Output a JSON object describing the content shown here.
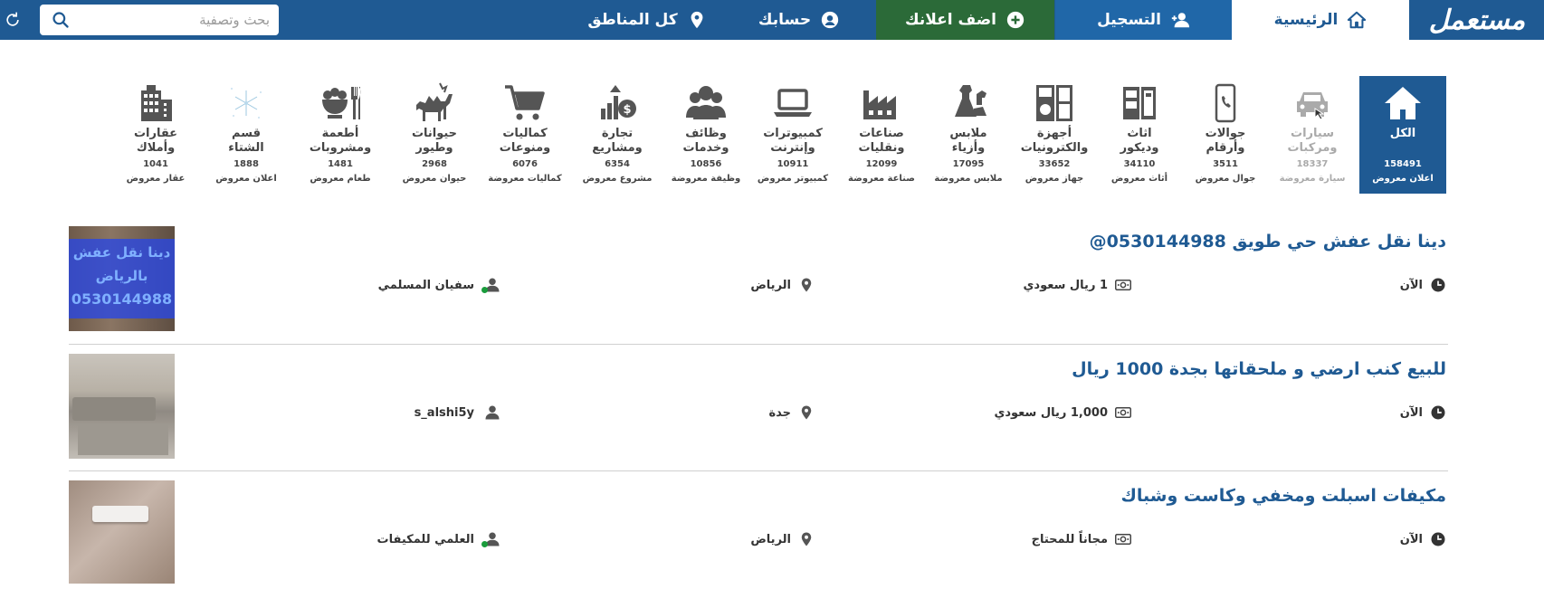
{
  "nav": {
    "logo": "مستعمل",
    "home": "الرئيسية",
    "register": "التسجيل",
    "add_ad": "اضف اعلانك",
    "account": "حسابك",
    "regions": "كل المناطق",
    "search_placeholder": "بحث وتصفية",
    "colors": {
      "bar": "#1f5a93",
      "add_button": "#2b6a38",
      "register_button": "#2067a8"
    }
  },
  "categories": [
    {
      "label1": "الكل",
      "label2": "",
      "count": "158491",
      "unit": "اعلان معروض",
      "icon": "home-icon",
      "active": true
    },
    {
      "label1": "سيارات",
      "label2": "ومركبات",
      "count": "18337",
      "unit": "سيارة معروضة",
      "icon": "car-icon",
      "hovered": true
    },
    {
      "label1": "جوالات",
      "label2": "وأرقام",
      "count": "3511",
      "unit": "جوال معروض",
      "icon": "phone-icon"
    },
    {
      "label1": "اثاث",
      "label2": "وديكور",
      "count": "34110",
      "unit": "أثاث معروض",
      "icon": "furniture-icon"
    },
    {
      "label1": "أجهزة",
      "label2": "والكترونيات",
      "count": "33652",
      "unit": "جهاز معروض",
      "icon": "appliances-icon"
    },
    {
      "label1": "ملابس",
      "label2": "وأزياء",
      "count": "17095",
      "unit": "ملابس معروضة",
      "icon": "clothes-icon"
    },
    {
      "label1": "صناعات",
      "label2": "ونقليات",
      "count": "12099",
      "unit": "صناعة معروضة",
      "icon": "factory-icon"
    },
    {
      "label1": "كمبيوترات",
      "label2": "وإنترنت",
      "count": "10911",
      "unit": "كمبيوتر معروض",
      "icon": "laptop-icon"
    },
    {
      "label1": "وظائف",
      "label2": "وخدمات",
      "count": "10856",
      "unit": "وظيفة معروضة",
      "icon": "people-icon"
    },
    {
      "label1": "تجارة",
      "label2": "ومشاريع",
      "count": "6354",
      "unit": "مشروع معروض",
      "icon": "business-growth-icon"
    },
    {
      "label1": "كماليات",
      "label2": "ومنوعات",
      "count": "6076",
      "unit": "كماليات معروضة",
      "icon": "cart-icon"
    },
    {
      "label1": "حيوانات",
      "label2": "وطيور",
      "count": "2968",
      "unit": "حيوان معروض",
      "icon": "camel-icon"
    },
    {
      "label1": "أطعمة",
      "label2": "ومشروبات",
      "count": "1481",
      "unit": "طعام معروض",
      "icon": "food-icon"
    },
    {
      "label1": "قسم",
      "label2": "الشتاء",
      "count": "1888",
      "unit": "اعلان معروض",
      "icon": "snowflake-icon"
    },
    {
      "label1": "عقارات",
      "label2": "وأملاك",
      "count": "1041",
      "unit": "عقار معروض",
      "icon": "building-icon"
    }
  ],
  "listings": [
    {
      "title": "دينا نقل عفش حي طويق 0530144988@",
      "time": "الآن",
      "price": "1 ريال سعودي",
      "city": "الرياض",
      "user": "سفيان المسلمي",
      "online": true,
      "thumb_text": [
        "دينا نقل عفش",
        "بالرياض",
        "0530144988"
      ]
    },
    {
      "title": "للبيع كنب ارضي و ملحقاتها بجدة 1000 ريال",
      "time": "الآن",
      "price": "1,000 ريال سعودي",
      "city": "جدة",
      "user": "s_alshi5y",
      "online": false
    },
    {
      "title": "مكيفات اسبلت ومخفي وكاست وشباك",
      "time": "الآن",
      "price": "مجاناً للمحتاج",
      "city": "الرياض",
      "user": "العلمي للمكيفات",
      "online": true
    }
  ]
}
